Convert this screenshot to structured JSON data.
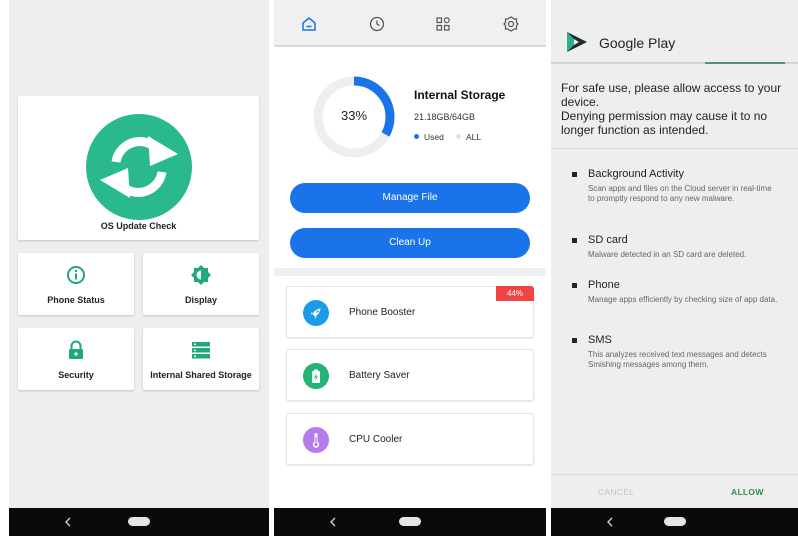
{
  "screen1": {
    "update_card": {
      "label": "OS Update Check",
      "icon": "sync-icon"
    },
    "tiles": [
      {
        "label": "Phone Status",
        "icon": "info-icon"
      },
      {
        "label": "Display",
        "icon": "brightness-icon"
      },
      {
        "label": "Security",
        "icon": "lock-icon"
      },
      {
        "label": "Internal Shared Storage",
        "icon": "storage-icon"
      }
    ]
  },
  "screen2": {
    "tabs": [
      "home-icon",
      "history-icon",
      "apps-icon",
      "settings-icon"
    ],
    "storage": {
      "percent_label": "33%",
      "used_fraction": 0.33,
      "title": "Internal Storage",
      "size": "21.18GB/64GB",
      "legend_used": "Used",
      "legend_all": "ALL"
    },
    "buttons": {
      "manage": "Manage File",
      "clean": "Clean Up"
    },
    "features": [
      {
        "label": "Phone Booster",
        "badge": "44%",
        "icon": "rocket-icon"
      },
      {
        "label": "Battery Saver",
        "badge": "",
        "icon": "battery-icon"
      },
      {
        "label": "CPU Cooler",
        "badge": "",
        "icon": "thermometer-icon"
      }
    ],
    "colors": {
      "primary": "#1a73e8",
      "ring_bg": "#eeeeee",
      "badge": "#ef4444"
    }
  },
  "screen3": {
    "title": "Google Play",
    "intro_line1": "For safe use, please allow access to your device.",
    "intro_line2": "Denying permission may cause it to no longer function as intended.",
    "permissions": [
      {
        "title": "Background Activity",
        "desc": "Scan apps and files on the Cloud server in real-time to promptly respond to any new malware."
      },
      {
        "title": "SD card",
        "desc": "Malware detected in an SD card are deleted."
      },
      {
        "title": "Phone",
        "desc": "Manage apps efficiently by checking size of app data."
      },
      {
        "title": "SMS",
        "desc": "This analyzes received text messages and detects Smishing messages among them."
      }
    ],
    "cancel": "CANCEL",
    "allow": "ALLOW"
  }
}
